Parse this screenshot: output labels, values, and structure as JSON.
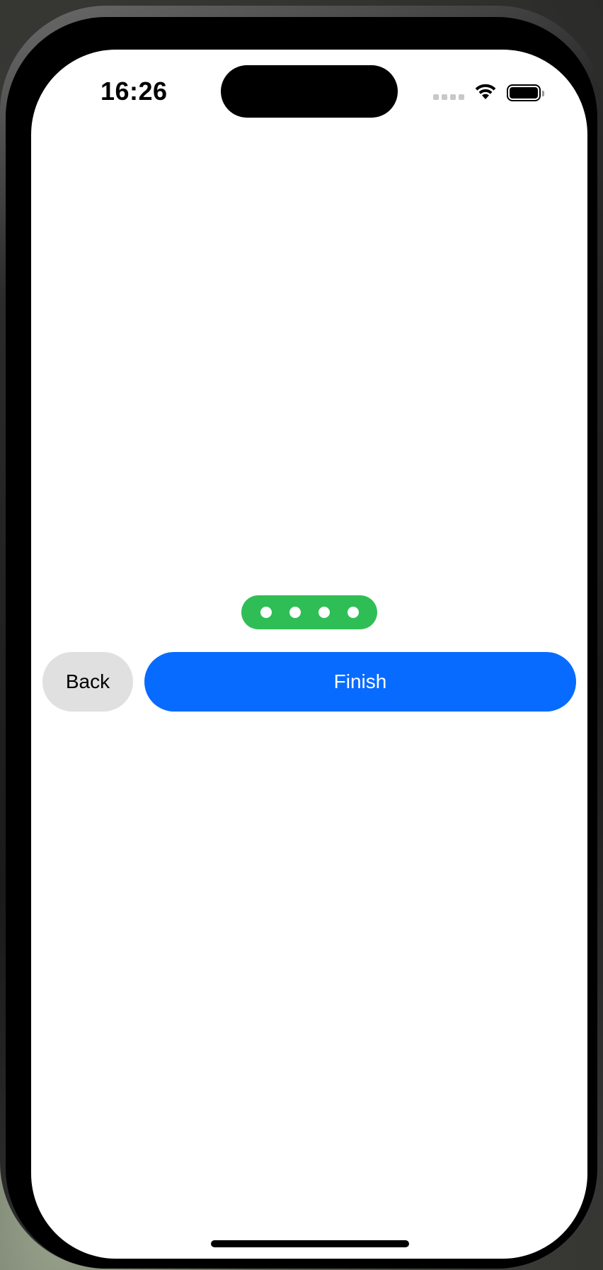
{
  "status_bar": {
    "time": "16:26",
    "signal_icon": "cellular-signal-icon",
    "wifi_icon": "wifi-icon",
    "battery_icon": "battery-icon",
    "battery_level": 1.0
  },
  "page_indicator": {
    "total_pages": 4,
    "color": "#2fbe55",
    "dot_color": "#ffffff"
  },
  "actions": {
    "back_label": "Back",
    "back_color": "#e0e0e0",
    "finish_label": "Finish",
    "finish_color": "#076bff"
  }
}
